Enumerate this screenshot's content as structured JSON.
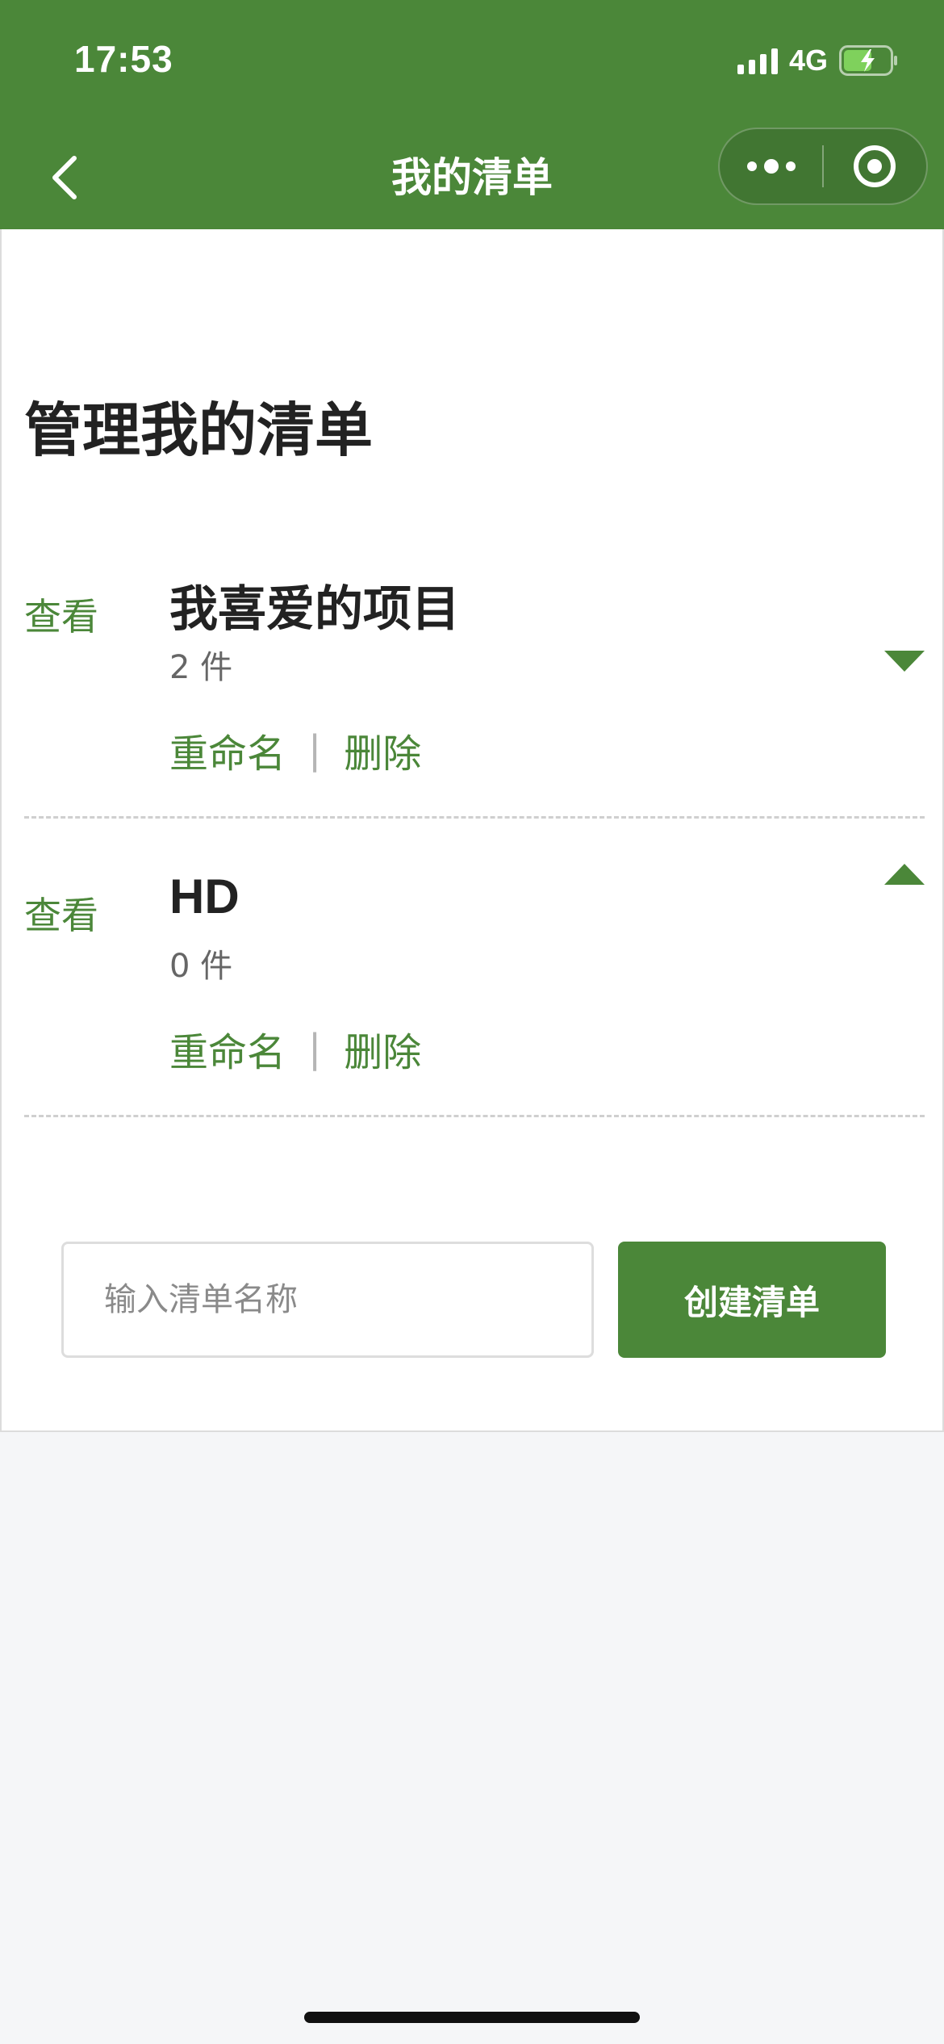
{
  "status_bar": {
    "time": "17:53",
    "network": "4G",
    "icons": [
      "signal-icon",
      "battery-charging-icon"
    ]
  },
  "nav": {
    "title": "我的清单",
    "icons": [
      "back-chevron-icon",
      "more-dots-icon",
      "target-close-icon"
    ]
  },
  "page": {
    "title": "管理我的清单"
  },
  "lists": [
    {
      "view_label": "查看",
      "name": "我喜爱的项目",
      "count": "2 件",
      "rename_label": "重命名",
      "separator": "|",
      "delete_label": "删除",
      "toggle_icon": "triangle-down-icon"
    },
    {
      "view_label": "查看",
      "name": "HD",
      "count": "0 件",
      "rename_label": "重命名",
      "separator": "|",
      "delete_label": "删除",
      "toggle_icon": "triangle-up-icon"
    }
  ],
  "create": {
    "placeholder": "输入清单名称",
    "value": "",
    "button_label": "创建清单"
  },
  "colors": {
    "brand_green": "#4b8739",
    "background": "#f5f6f8",
    "panel": "#ffffff"
  }
}
